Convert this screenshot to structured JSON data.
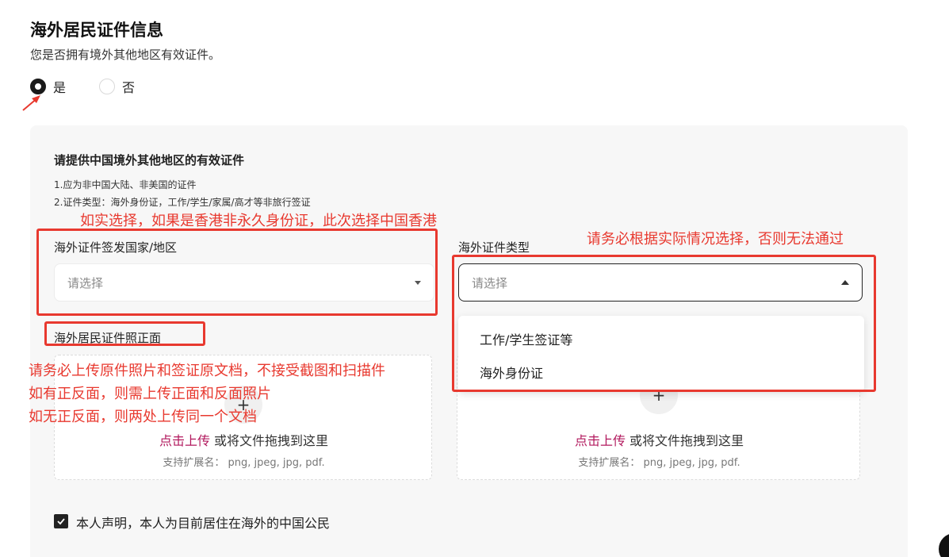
{
  "header": {
    "title": "海外居民证件信息",
    "subtitle": "您是否拥有境外其他地区有效证件。"
  },
  "radio": {
    "yes_label": "是",
    "no_label": "否",
    "selected": "yes"
  },
  "section": {
    "title": "请提供中国境外其他地区的有效证件",
    "note_1": "1.应为非中国大陆、非美国的证件",
    "note_2": "2.证件类型：海外身份证，工作/学生/家属/高才等非旅行签证"
  },
  "country_field": {
    "label": "海外证件签发国家/地区",
    "placeholder": "请选择"
  },
  "type_field": {
    "label": "海外证件类型",
    "placeholder": "请选择",
    "options": [
      "工作/学生签证等",
      "海外身份证"
    ]
  },
  "front_upload": {
    "label": "海外居民证件照正面",
    "link_text": "点击上传",
    "main_text": " 或将文件拖拽到这里",
    "hint": "支持扩展名： png, jpeg, jpg, pdf."
  },
  "back_upload": {
    "link_text": "点击上传",
    "main_text": " 或将文件拖拽到这里",
    "hint": "支持扩展名： png, jpeg, jpg, pdf."
  },
  "declaration": {
    "label": "本人声明，本人为目前居住在海外的中国公民",
    "checked": true
  },
  "annotations": {
    "country_note": "如实选择，如果是香港非永久身份证，此次选择中国香港",
    "type_note": "请务必根据实际情况选择，否则无法通过",
    "upload_note_1": "请务必上传原件照片和签证原文档，不接受截图和扫描件",
    "upload_note_2": "如有正反面，则需上传正面和反面照片",
    "upload_note_3": "如无正反面，则两处上传同一个文档"
  },
  "colors": {
    "accent_link": "#b2185d",
    "annotation_red": "#e8392f",
    "panel_bg": "#f7f7f7"
  }
}
